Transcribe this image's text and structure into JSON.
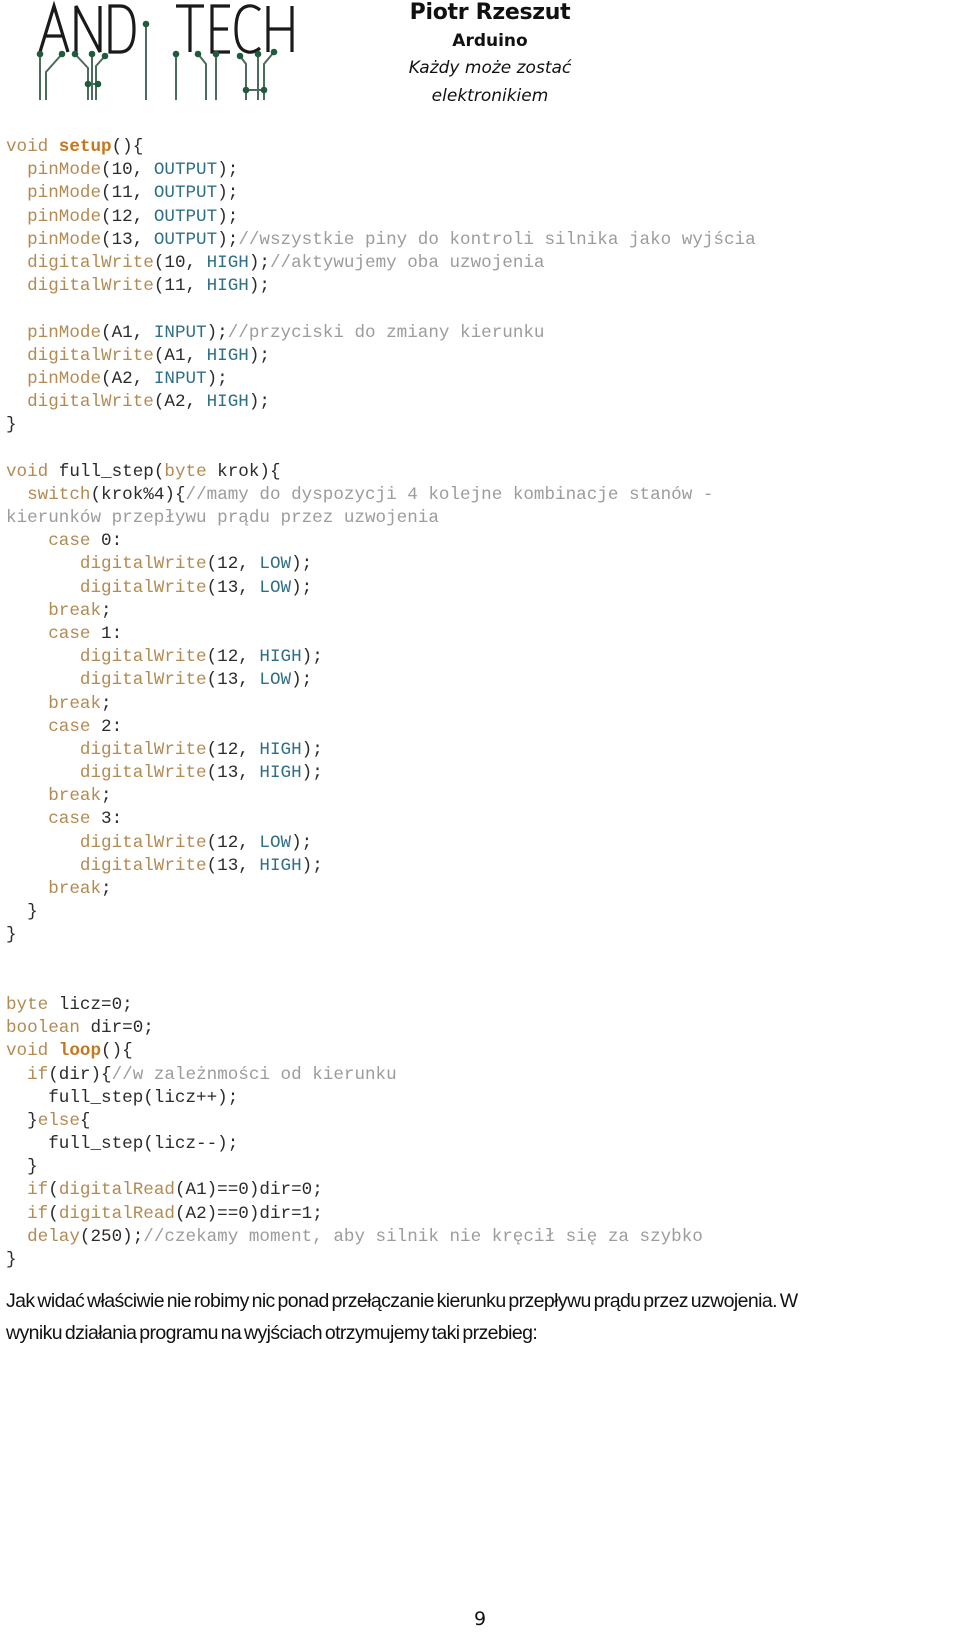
{
  "header": {
    "logo_text": "AND TECH",
    "author": "Piotr Rzeszut",
    "subject": "Arduino",
    "motto_line1": "Każdy może zostać",
    "motto_line2": "elektronikiem"
  },
  "colors": {
    "keyword": "#b38a52",
    "function_bold": "#c5771e",
    "constant": "#2f6f86",
    "comment": "#9c9c9c",
    "text": "#2b2b2b",
    "logo_green": "#1f5c3d"
  },
  "code_lines": [
    [
      [
        "kw",
        "void "
      ],
      [
        "kwb",
        "setup"
      ],
      [
        "plain",
        "(){"
      ]
    ],
    [
      [
        "plain",
        "  "
      ],
      [
        "kw",
        "pinMode"
      ],
      [
        "plain",
        "(10, "
      ],
      [
        "const",
        "OUTPUT"
      ],
      [
        "plain",
        ");"
      ]
    ],
    [
      [
        "plain",
        "  "
      ],
      [
        "kw",
        "pinMode"
      ],
      [
        "plain",
        "(11, "
      ],
      [
        "const",
        "OUTPUT"
      ],
      [
        "plain",
        ");"
      ]
    ],
    [
      [
        "plain",
        "  "
      ],
      [
        "kw",
        "pinMode"
      ],
      [
        "plain",
        "(12, "
      ],
      [
        "const",
        "OUTPUT"
      ],
      [
        "plain",
        ");"
      ]
    ],
    [
      [
        "plain",
        "  "
      ],
      [
        "kw",
        "pinMode"
      ],
      [
        "plain",
        "(13, "
      ],
      [
        "const",
        "OUTPUT"
      ],
      [
        "plain",
        ");"
      ],
      [
        "cmt",
        "//wszystkie piny do kontroli silnika jako wyjścia"
      ]
    ],
    [
      [
        "plain",
        "  "
      ],
      [
        "kw",
        "digitalWrite"
      ],
      [
        "plain",
        "(10, "
      ],
      [
        "const",
        "HIGH"
      ],
      [
        "plain",
        ");"
      ],
      [
        "cmt",
        "//aktywujemy oba uzwojenia"
      ]
    ],
    [
      [
        "plain",
        "  "
      ],
      [
        "kw",
        "digitalWrite"
      ],
      [
        "plain",
        "(11, "
      ],
      [
        "const",
        "HIGH"
      ],
      [
        "plain",
        ");"
      ]
    ],
    [],
    [
      [
        "plain",
        "  "
      ],
      [
        "kw",
        "pinMode"
      ],
      [
        "plain",
        "(A1, "
      ],
      [
        "const",
        "INPUT"
      ],
      [
        "plain",
        ");"
      ],
      [
        "cmt",
        "//przyciski do zmiany kierunku"
      ]
    ],
    [
      [
        "plain",
        "  "
      ],
      [
        "kw",
        "digitalWrite"
      ],
      [
        "plain",
        "(A1, "
      ],
      [
        "const",
        "HIGH"
      ],
      [
        "plain",
        ");"
      ]
    ],
    [
      [
        "plain",
        "  "
      ],
      [
        "kw",
        "pinMode"
      ],
      [
        "plain",
        "(A2, "
      ],
      [
        "const",
        "INPUT"
      ],
      [
        "plain",
        ");"
      ]
    ],
    [
      [
        "plain",
        "  "
      ],
      [
        "kw",
        "digitalWrite"
      ],
      [
        "plain",
        "(A2, "
      ],
      [
        "const",
        "HIGH"
      ],
      [
        "plain",
        ");"
      ]
    ],
    [
      [
        "plain",
        "}"
      ]
    ],
    [],
    [
      [
        "kw",
        "void "
      ],
      [
        "plain",
        "full_step("
      ],
      [
        "kw",
        "byte"
      ],
      [
        "plain",
        " krok){"
      ]
    ],
    [
      [
        "plain",
        "  "
      ],
      [
        "kw",
        "switch"
      ],
      [
        "plain",
        "(krok%4){"
      ],
      [
        "cmt",
        "//mamy do dyspozycji 4 kolejne kombinacje stanów -"
      ]
    ],
    [
      [
        "cmt",
        "kierunków przepływu prądu przez uzwojenia"
      ]
    ],
    [
      [
        "plain",
        "    "
      ],
      [
        "kw",
        "case"
      ],
      [
        "plain",
        " 0:"
      ]
    ],
    [
      [
        "plain",
        "       "
      ],
      [
        "kw",
        "digitalWrite"
      ],
      [
        "plain",
        "(12, "
      ],
      [
        "const",
        "LOW"
      ],
      [
        "plain",
        ");"
      ]
    ],
    [
      [
        "plain",
        "       "
      ],
      [
        "kw",
        "digitalWrite"
      ],
      [
        "plain",
        "(13, "
      ],
      [
        "const",
        "LOW"
      ],
      [
        "plain",
        ");"
      ]
    ],
    [
      [
        "plain",
        "    "
      ],
      [
        "kw",
        "break"
      ],
      [
        "plain",
        ";"
      ]
    ],
    [
      [
        "plain",
        "    "
      ],
      [
        "kw",
        "case"
      ],
      [
        "plain",
        " 1:"
      ]
    ],
    [
      [
        "plain",
        "       "
      ],
      [
        "kw",
        "digitalWrite"
      ],
      [
        "plain",
        "(12, "
      ],
      [
        "const",
        "HIGH"
      ],
      [
        "plain",
        ");"
      ]
    ],
    [
      [
        "plain",
        "       "
      ],
      [
        "kw",
        "digitalWrite"
      ],
      [
        "plain",
        "(13, "
      ],
      [
        "const",
        "LOW"
      ],
      [
        "plain",
        ");"
      ]
    ],
    [
      [
        "plain",
        "    "
      ],
      [
        "kw",
        "break"
      ],
      [
        "plain",
        ";"
      ]
    ],
    [
      [
        "plain",
        "    "
      ],
      [
        "kw",
        "case"
      ],
      [
        "plain",
        " 2:"
      ]
    ],
    [
      [
        "plain",
        "       "
      ],
      [
        "kw",
        "digitalWrite"
      ],
      [
        "plain",
        "(12, "
      ],
      [
        "const",
        "HIGH"
      ],
      [
        "plain",
        ");"
      ]
    ],
    [
      [
        "plain",
        "       "
      ],
      [
        "kw",
        "digitalWrite"
      ],
      [
        "plain",
        "(13, "
      ],
      [
        "const",
        "HIGH"
      ],
      [
        "plain",
        ");"
      ]
    ],
    [
      [
        "plain",
        "    "
      ],
      [
        "kw",
        "break"
      ],
      [
        "plain",
        ";"
      ]
    ],
    [
      [
        "plain",
        "    "
      ],
      [
        "kw",
        "case"
      ],
      [
        "plain",
        " 3:"
      ]
    ],
    [
      [
        "plain",
        "       "
      ],
      [
        "kw",
        "digitalWrite"
      ],
      [
        "plain",
        "(12, "
      ],
      [
        "const",
        "LOW"
      ],
      [
        "plain",
        ");"
      ]
    ],
    [
      [
        "plain",
        "       "
      ],
      [
        "kw",
        "digitalWrite"
      ],
      [
        "plain",
        "(13, "
      ],
      [
        "const",
        "HIGH"
      ],
      [
        "plain",
        ");"
      ]
    ],
    [
      [
        "plain",
        "    "
      ],
      [
        "kw",
        "break"
      ],
      [
        "plain",
        ";"
      ]
    ],
    [
      [
        "plain",
        "  }"
      ]
    ],
    [
      [
        "plain",
        "}"
      ]
    ],
    [],
    [],
    [
      [
        "kw",
        "byte"
      ],
      [
        "plain",
        " licz=0;"
      ]
    ],
    [
      [
        "kw",
        "boolean"
      ],
      [
        "plain",
        " dir=0;"
      ]
    ],
    [
      [
        "kw",
        "void "
      ],
      [
        "kwb",
        "loop"
      ],
      [
        "plain",
        "(){"
      ]
    ],
    [
      [
        "plain",
        "  "
      ],
      [
        "kw",
        "if"
      ],
      [
        "plain",
        "(dir){"
      ],
      [
        "cmt",
        "//w zależnmości od kierunku"
      ]
    ],
    [
      [
        "plain",
        "    full_step(licz++);"
      ]
    ],
    [
      [
        "plain",
        "  }"
      ],
      [
        "kw",
        "else"
      ],
      [
        "plain",
        "{"
      ]
    ],
    [
      [
        "plain",
        "    full_step(licz--);"
      ]
    ],
    [
      [
        "plain",
        "  }"
      ]
    ],
    [
      [
        "plain",
        "  "
      ],
      [
        "kw",
        "if"
      ],
      [
        "plain",
        "("
      ],
      [
        "kw",
        "digitalRead"
      ],
      [
        "plain",
        "(A1)==0)dir=0;"
      ]
    ],
    [
      [
        "plain",
        "  "
      ],
      [
        "kw",
        "if"
      ],
      [
        "plain",
        "("
      ],
      [
        "kw",
        "digitalRead"
      ],
      [
        "plain",
        "(A2)==0)dir=1;"
      ]
    ],
    [
      [
        "plain",
        "  "
      ],
      [
        "kw",
        "delay"
      ],
      [
        "plain",
        "(250);"
      ],
      [
        "cmt",
        "//czekamy moment, aby silnik nie kręcił się za szybko"
      ]
    ],
    [
      [
        "plain",
        "}"
      ]
    ]
  ],
  "paragraph": {
    "line1": "Jak widać właściwie nie robimy nic ponad przełączanie kierunku przepływu prądu przez uzwojenia. W",
    "line2": "wyniku działania programu na wyjściach otrzymujemy taki przebieg:"
  },
  "page_number": "9"
}
